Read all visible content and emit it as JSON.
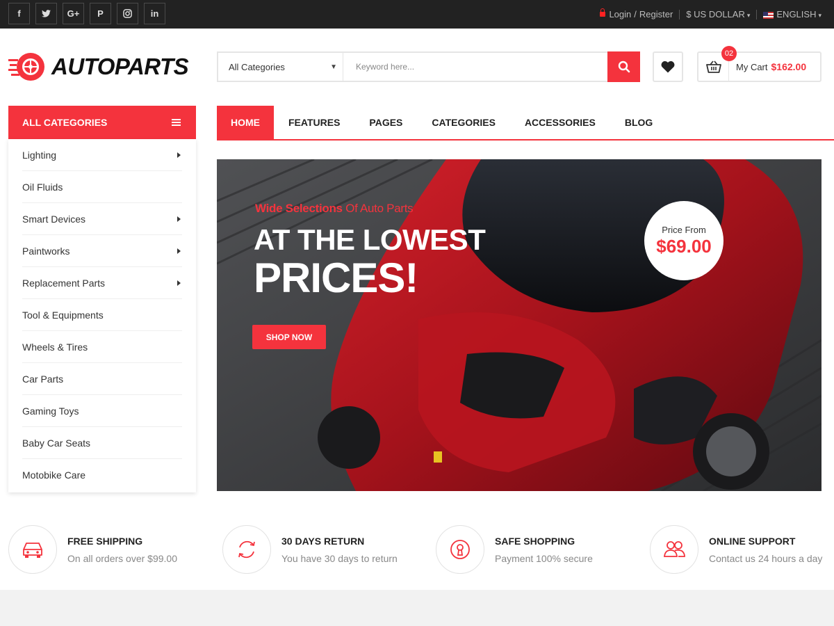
{
  "topbar": {
    "social": [
      {
        "name": "facebook-icon",
        "glyph": "f"
      },
      {
        "name": "twitter-icon",
        "glyph": "t"
      },
      {
        "name": "google-plus-icon",
        "glyph": "G+"
      },
      {
        "name": "pinterest-icon",
        "glyph": "P"
      },
      {
        "name": "instagram-icon",
        "glyph": "◎"
      },
      {
        "name": "linkedin-icon",
        "glyph": "in"
      }
    ],
    "login": "Login",
    "slash": "/",
    "register": "Register",
    "currency": "$ US DOLLAR",
    "language": "ENGLISH"
  },
  "header": {
    "logo": "AUTOPARTS",
    "category_select": "All Categories",
    "search_placeholder": "Keyword here...",
    "cart_count": "02",
    "cart_label": "My Cart",
    "cart_total": "$162.00"
  },
  "sidebar": {
    "title": "ALL CATEGORIES",
    "items": [
      {
        "label": "Lighting",
        "submenu": true
      },
      {
        "label": "Oil Fluids",
        "submenu": false
      },
      {
        "label": "Smart Devices",
        "submenu": true
      },
      {
        "label": "Paintworks",
        "submenu": true
      },
      {
        "label": "Replacement Parts",
        "submenu": true
      },
      {
        "label": "Tool & Equipments",
        "submenu": false
      },
      {
        "label": "Wheels & Tires",
        "submenu": false
      },
      {
        "label": "Car Parts",
        "submenu": false
      },
      {
        "label": "Gaming Toys",
        "submenu": false
      },
      {
        "label": "Baby Car Seats",
        "submenu": false
      },
      {
        "label": "Motobike Care",
        "submenu": false
      }
    ]
  },
  "nav": {
    "items": [
      "HOME",
      "FEATURES",
      "PAGES",
      "CATEGORIES",
      "ACCESSORIES",
      "BLOG"
    ],
    "active": 0
  },
  "hero": {
    "kicker_bold": "Wide Selections",
    "kicker_rest": "Of Auto Parts",
    "headline_1": "AT THE LOWEST",
    "headline_2": "PRICES!",
    "button": "SHOP NOW",
    "price_label": "Price From",
    "price_value": "$69.00"
  },
  "features": [
    {
      "icon": "car-icon",
      "title": "FREE SHIPPING",
      "desc": "On all orders over $99.00"
    },
    {
      "icon": "return-icon",
      "title": "30 DAYS RETURN",
      "desc": "You have 30 days to return"
    },
    {
      "icon": "lock-icon",
      "title": "SAFE SHOPPING",
      "desc": "Payment 100% secure"
    },
    {
      "icon": "support-icon",
      "title": "ONLINE SUPPORT",
      "desc": "Contact us 24 hours a day"
    }
  ],
  "colors": {
    "accent": "#f4333d",
    "topbar": "#222222"
  }
}
